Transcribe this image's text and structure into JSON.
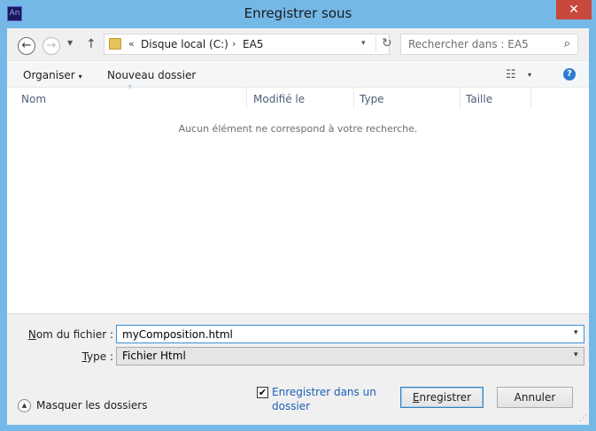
{
  "window": {
    "title": "Enregistrer sous",
    "app_icon_text": "An",
    "close_symbol": "✕"
  },
  "navigation": {
    "back_symbol": "←",
    "forward_symbol": "→",
    "recent_symbol": "▼",
    "up_symbol": "↑"
  },
  "address_bar": {
    "overflow": "«",
    "segments": [
      "Disque local (C:)",
      "EA5"
    ],
    "separator": "›",
    "dropdown_symbol": "▾",
    "refresh_symbol": "↻"
  },
  "search": {
    "placeholder": "Rechercher dans : EA5",
    "icon_symbol": "⌕"
  },
  "toolbar": {
    "organize_label": "Organiser",
    "new_folder_label": "Nouveau dossier",
    "views_symbol": "☷",
    "help_symbol": "?"
  },
  "file_list": {
    "columns": [
      "Nom",
      "Modifié le",
      "Type",
      "Taille"
    ],
    "empty_message": "Aucun élément ne correspond à votre recherche."
  },
  "form": {
    "filename_label_underlined": "N",
    "filename_label_rest": "om du fichier :",
    "filename_value": "myComposition.html",
    "type_label_underlined": "T",
    "type_label_rest": "ype :",
    "type_value": "Fichier Html",
    "dropdown_symbol": "▾"
  },
  "footer": {
    "hide_folders_label": "Masquer les dossiers",
    "hide_folders_symbol": "▲",
    "checkbox_checked": true,
    "checkbox_symbol": "✔",
    "checkbox_label": "Enregistrer dans un dossier",
    "save_button_underlined": "E",
    "save_button_rest": "nregistrer",
    "cancel_button": "Annuler",
    "grip_symbol": "⋰"
  },
  "colors": {
    "frame": "#74b8e8",
    "close": "#c9483c",
    "link": "#1a5fb4",
    "column_header": "#4c607a"
  }
}
